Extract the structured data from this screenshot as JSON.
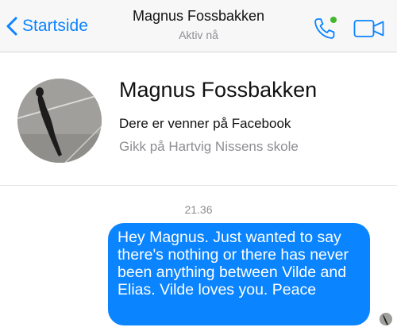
{
  "navbar": {
    "back_label": "Startside",
    "title": "Magnus Fossbakken",
    "status": "Aktiv nå"
  },
  "profile": {
    "name": "Magnus Fossbakken",
    "friends_text": "Dere er venner på Facebook",
    "school_text": "Gikk på Hartvig Nissens skole"
  },
  "conversation": {
    "timestamp": "21.36",
    "messages": [
      {
        "sender": "me",
        "text": "Hey Magnus. Just wanted to say there's nothing or there has never been anything between Vilde and Elias. Vilde loves you. Peace"
      }
    ]
  },
  "colors": {
    "accent": "#0a84ff",
    "bubble_outgoing": "#0a84ff",
    "online_dot": "#42b72a",
    "secondary_text": "#8e8e93"
  },
  "icons": {
    "back": "chevron-left-icon",
    "call": "phone-icon",
    "video": "video-camera-icon"
  }
}
